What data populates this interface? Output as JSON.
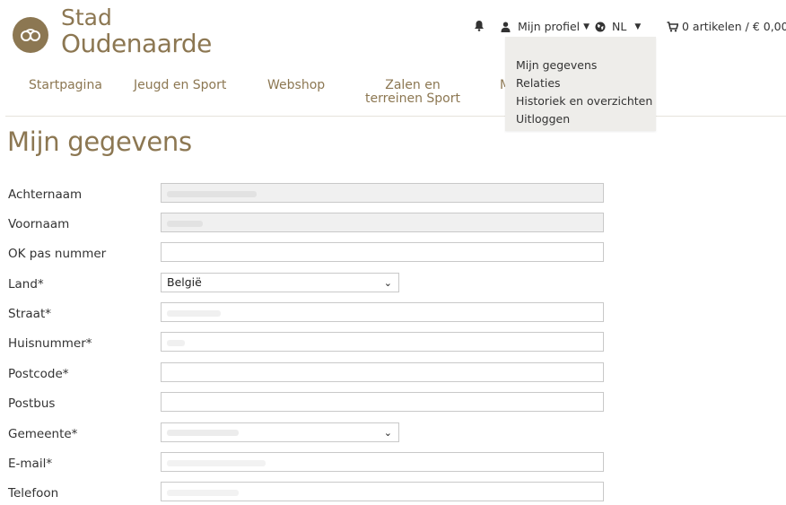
{
  "brand": {
    "line1": "Stad",
    "line2": "Oudenaarde",
    "color": "#8c7752"
  },
  "topbar": {
    "profile_label": "Mijn profiel",
    "language_label": "NL",
    "cart_label": "0 artikelen / € 0,00"
  },
  "nav": {
    "items": [
      {
        "label": "Startpagina"
      },
      {
        "label": "Jeugd en Sport"
      },
      {
        "label": "Webshop"
      },
      {
        "label": "Zalen en terreinen Sport"
      },
      {
        "label": "M"
      }
    ]
  },
  "profile_menu": {
    "items": [
      {
        "label": "Mijn gegevens"
      },
      {
        "label": "Relaties"
      },
      {
        "label": "Historiek en overzichten"
      },
      {
        "label": "Uitloggen"
      }
    ]
  },
  "page": {
    "title": "Mijn gegevens"
  },
  "form": {
    "fields": [
      {
        "label": "Achternaam",
        "type": "text",
        "readonly": true
      },
      {
        "label": "Voornaam",
        "type": "text",
        "readonly": true
      },
      {
        "label": "OK pas nummer",
        "type": "text"
      },
      {
        "label": "Land*",
        "type": "select",
        "value": "België"
      },
      {
        "label": "Straat*",
        "type": "text"
      },
      {
        "label": "Huisnummer*",
        "type": "text"
      },
      {
        "label": "Postcode*",
        "type": "text"
      },
      {
        "label": "Postbus",
        "type": "text"
      },
      {
        "label": "Gemeente*",
        "type": "select"
      },
      {
        "label": "E-mail*",
        "type": "text"
      },
      {
        "label": "Telefoon",
        "type": "text"
      }
    ]
  }
}
